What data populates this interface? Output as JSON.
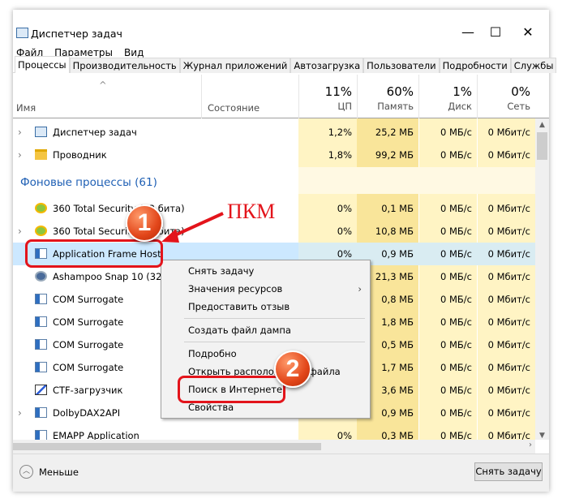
{
  "window": {
    "title": "Диспетчер задач",
    "minimize": "—",
    "maximize": "☐",
    "close": "✕"
  },
  "menu": [
    "Файл",
    "Параметры",
    "Вид"
  ],
  "tabs": [
    "Процессы",
    "Производительность",
    "Журнал приложений",
    "Автозагрузка",
    "Пользователи",
    "Подробности",
    "Службы"
  ],
  "header": {
    "name": "Имя",
    "status": "Состояние",
    "sort_arrow": "^",
    "cpu_pct": "11%",
    "cpu": "ЦП",
    "mem_pct": "60%",
    "mem": "Память",
    "disk_pct": "1%",
    "disk": "Диск",
    "net_pct": "0%",
    "net": "Сеть"
  },
  "group_label": "Фоновые процессы (61)",
  "apps": [
    {
      "name": "Диспетчер задач",
      "cpu": "1,2%",
      "mem": "25,2 МБ",
      "disk": "0 МБ/с",
      "net": "0 Мбит/с",
      "expand": true,
      "icon": "task-manager-icon"
    },
    {
      "name": "Проводник",
      "cpu": "1,8%",
      "mem": "99,2 МБ",
      "disk": "0 МБ/с",
      "net": "0 Мбит/с",
      "expand": true,
      "icon": "folder-icon"
    }
  ],
  "background": [
    {
      "name": "360 Total Security (32 бита)",
      "cpu": "0%",
      "mem": "0,1 МБ",
      "disk": "0 МБ/с",
      "net": "0 Мбит/с",
      "expand": false,
      "icon": "360-icon"
    },
    {
      "name": "360 Total Security (32 бита)",
      "cpu": "0%",
      "mem": "10,8 МБ",
      "disk": "0 МБ/с",
      "net": "0 Мбит/с",
      "expand": true,
      "icon": "360-icon"
    },
    {
      "name": "Application Frame Host",
      "cpu": "0%",
      "mem": "0,9 МБ",
      "disk": "0 МБ/с",
      "net": "0 Мбит/с",
      "expand": false,
      "icon": "window-icon",
      "selected": true
    },
    {
      "name": "Ashampoo Snap 10 (32 6",
      "cpu": "",
      "mem": "21,3 МБ",
      "disk": "0 МБ/с",
      "net": "0 Мбит/с",
      "expand": false,
      "icon": "ashampoo-icon"
    },
    {
      "name": "COM Surrogate",
      "cpu": "",
      "mem": "0,8 МБ",
      "disk": "0 МБ/с",
      "net": "0 Мбит/с",
      "expand": false,
      "icon": "window-icon"
    },
    {
      "name": "COM Surrogate",
      "cpu": "",
      "mem": "1,8 МБ",
      "disk": "0 МБ/с",
      "net": "0 Мбит/с",
      "expand": false,
      "icon": "window-icon"
    },
    {
      "name": "COM Surrogate",
      "cpu": "",
      "mem": "0,5 МБ",
      "disk": "0 МБ/с",
      "net": "0 Мбит/с",
      "expand": false,
      "icon": "window-icon"
    },
    {
      "name": "COM Surrogate",
      "cpu": "",
      "mem": "1,7 МБ",
      "disk": "0 МБ/с",
      "net": "0 Мбит/с",
      "expand": false,
      "icon": "window-icon"
    },
    {
      "name": "CTF-загрузчик",
      "cpu": "",
      "mem": "3,6 МБ",
      "disk": "0 МБ/с",
      "net": "0 Мбит/с",
      "expand": false,
      "icon": "ctf-icon"
    },
    {
      "name": "DolbyDAX2API",
      "cpu": "",
      "mem": "0,9 МБ",
      "disk": "0 МБ/с",
      "net": "0 Мбит/с",
      "expand": true,
      "icon": "window-icon"
    },
    {
      "name": "EMAPP Application",
      "cpu": "0%",
      "mem": "0,3 МБ",
      "disk": "0 МБ/с",
      "net": "0 Мбит/с",
      "expand": false,
      "icon": "window-icon"
    }
  ],
  "context_menu": [
    "Снять задачу",
    "Значения ресурсов",
    "Предоставить отзыв",
    "Создать файл дампа",
    "Подробно",
    "Открыть расположение файла",
    "Поиск в Интернете",
    "Свойства"
  ],
  "footer": {
    "less": "Меньше",
    "end_task": "Снять задачу"
  },
  "annotations": {
    "pkm": "ПКМ",
    "step1": "1",
    "step2": "2"
  },
  "colors": {
    "heat_light": "#fff4c4",
    "heat_mem": "#f9e59a",
    "selected": "#cce8ff",
    "annotation": "#e3141b",
    "group": "#1e5fb4"
  }
}
